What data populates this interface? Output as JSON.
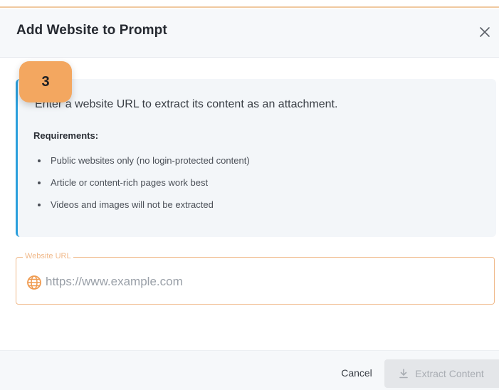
{
  "dialog": {
    "title": "Add Website to Prompt",
    "close_icon": "close-icon"
  },
  "step_badge": "3",
  "info": {
    "intro": "Enter a website URL to extract its content as an attachment.",
    "requirements_heading": "Requirements:",
    "requirements": [
      "Public websites only (no login-protected content)",
      "Article or content-rich pages work best",
      "Videos and images will not be extracted"
    ]
  },
  "url_field": {
    "label": "Website URL",
    "placeholder": "https://www.example.com",
    "value": "",
    "icon": "globe-icon"
  },
  "footer": {
    "cancel_label": "Cancel",
    "extract_label": "Extract Content",
    "extract_icon": "download-icon"
  },
  "colors": {
    "accent_orange": "#f3a760",
    "info_border_blue": "#2b9fdc",
    "disabled_button": "#e4e6e9"
  }
}
